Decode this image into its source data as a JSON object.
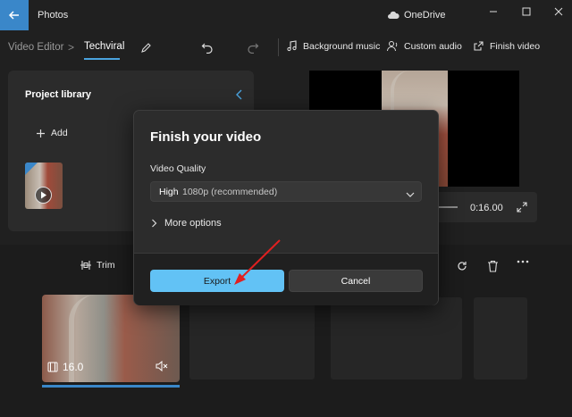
{
  "titlebar": {
    "app_title": "Photos",
    "onedrive_label": "OneDrive"
  },
  "toolbar": {
    "breadcrumb_root": "Video Editor",
    "breadcrumb_separator": ">",
    "project_name": "Techviral",
    "background_music": "Background music",
    "custom_audio": "Custom audio",
    "finish_video": "Finish video"
  },
  "library": {
    "title": "Project library",
    "add_label": "Add"
  },
  "player": {
    "time": "0:16.00"
  },
  "storyboard": {
    "trim_label": "Trim",
    "clip_duration": "16.0"
  },
  "dialog": {
    "title": "Finish your video",
    "quality_label": "Video Quality",
    "quality_value": "High",
    "quality_detail": "1080p (recommended)",
    "more_options": "More options",
    "export_label": "Export",
    "cancel_label": "Cancel"
  },
  "colors": {
    "accent": "#62c2f5",
    "back_button": "#3a87c9",
    "annotation_arrow": "#e02020"
  }
}
